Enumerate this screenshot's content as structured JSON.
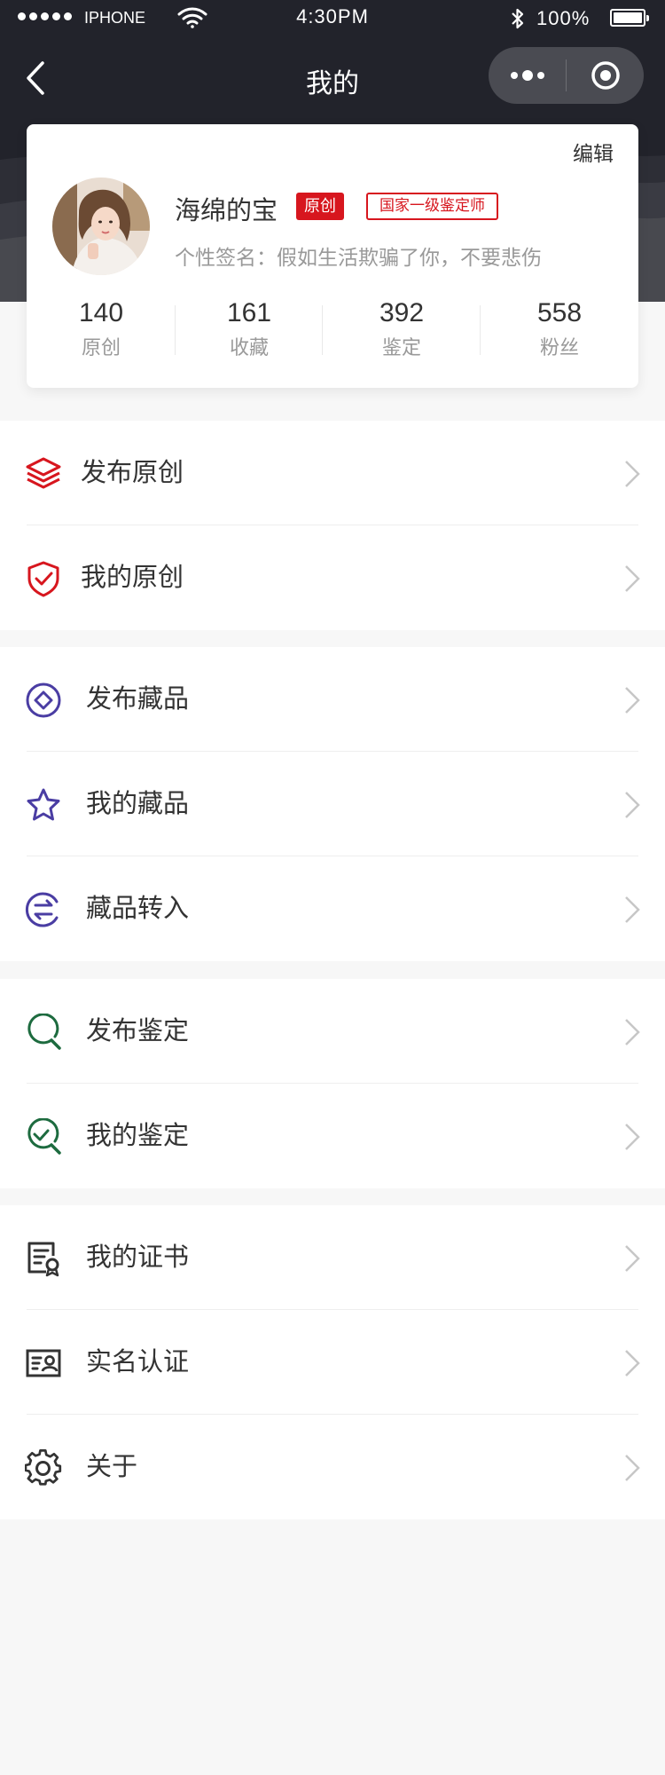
{
  "status_bar": {
    "carrier": "IPHONE",
    "time": "4:30PM",
    "battery": "100%",
    "battery_level": 1.0
  },
  "nav": {
    "title": "我的"
  },
  "profile": {
    "edit_label": "编辑",
    "name": "海绵的宝",
    "badge_original": "原创",
    "badge_level": "国家一级鉴定师",
    "signature": "个性签名：假如生活欺骗了你，不要悲伤",
    "stats": [
      {
        "value": "140",
        "label": "原创"
      },
      {
        "value": "161",
        "label": "收藏"
      },
      {
        "value": "392",
        "label": "鉴定"
      },
      {
        "value": "558",
        "label": "粉丝"
      }
    ]
  },
  "menu_groups": [
    {
      "items": [
        {
          "label": "发布原创",
          "icon": "layers-icon",
          "color": "#d7161e"
        },
        {
          "label": "我的原创",
          "icon": "shield-check-icon",
          "color": "#d7161e"
        }
      ]
    },
    {
      "items": [
        {
          "label": "发布藏品",
          "icon": "diamond-circle-icon",
          "color": "#4a3da3"
        },
        {
          "label": "我的藏品",
          "icon": "star-icon",
          "color": "#4a3da3"
        },
        {
          "label": "藏品转入",
          "icon": "transfer-icon",
          "color": "#4a3da3"
        }
      ]
    },
    {
      "items": [
        {
          "label": "发布鉴定",
          "icon": "magnifier-icon",
          "color": "#1d6b3f"
        },
        {
          "label": "我的鉴定",
          "icon": "magnifier-check-icon",
          "color": "#1d6b3f"
        }
      ]
    },
    {
      "items": [
        {
          "label": "我的证书",
          "icon": "certificate-icon",
          "color": "#333333"
        },
        {
          "label": "实名认证",
          "icon": "id-card-icon",
          "color": "#333333"
        },
        {
          "label": "关于",
          "icon": "gear-icon",
          "color": "#333333"
        }
      ]
    }
  ]
}
